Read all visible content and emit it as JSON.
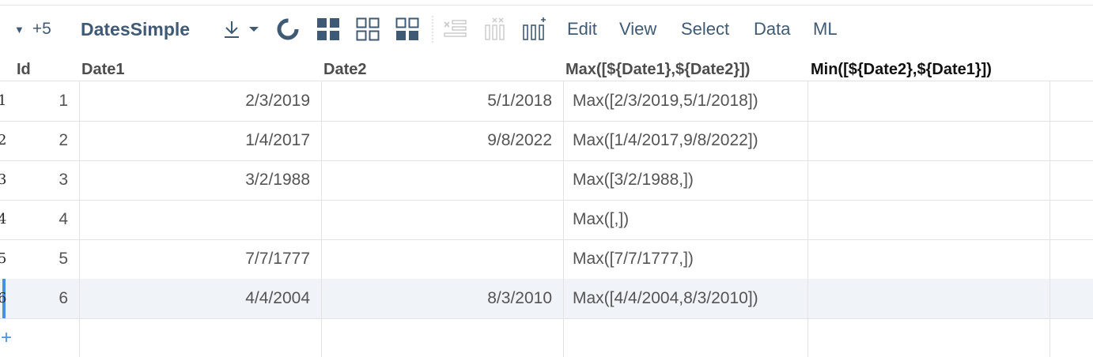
{
  "toolbar": {
    "collapse_icon": "triangle-down-icon",
    "count": "+5",
    "table_name": "DatesSimple",
    "menus": [
      "Edit",
      "View",
      "Select",
      "Data",
      "ML"
    ]
  },
  "grid": {
    "columns": [
      "Id",
      "Date1",
      "Date2",
      "Max([${Date1},${Date2}])",
      "Min([${Date2},${Date1}])"
    ],
    "rows": [
      {
        "rownum": "1",
        "id": "1",
        "date1": "2/3/2019",
        "date2": "5/1/2018",
        "max": "Max([2/3/2019,5/1/2018])",
        "min": ""
      },
      {
        "rownum": "2",
        "id": "2",
        "date1": "1/4/2017",
        "date2": "9/8/2022",
        "max": "Max([1/4/2017,9/8/2022])",
        "min": ""
      },
      {
        "rownum": "3",
        "id": "3",
        "date1": "3/2/1988",
        "date2": "",
        "max": "Max([3/2/1988,])",
        "min": ""
      },
      {
        "rownum": "4",
        "id": "4",
        "date1": "",
        "date2": "",
        "max": "Max([,])",
        "min": ""
      },
      {
        "rownum": "5",
        "id": "5",
        "date1": "7/7/1777",
        "date2": "",
        "max": "Max([7/7/1777,])",
        "min": ""
      },
      {
        "rownum": "6",
        "id": "6",
        "date1": "4/4/2004",
        "date2": "8/3/2010",
        "max": "Max([4/4/2004,8/3/2010])",
        "min": ""
      }
    ],
    "selected_row": 6,
    "add_row_symbol": "+"
  },
  "colors": {
    "accent": "#4a90e2",
    "toolbar_text": "#3f5a74",
    "selected_row_bg": "#f0f3f7"
  }
}
